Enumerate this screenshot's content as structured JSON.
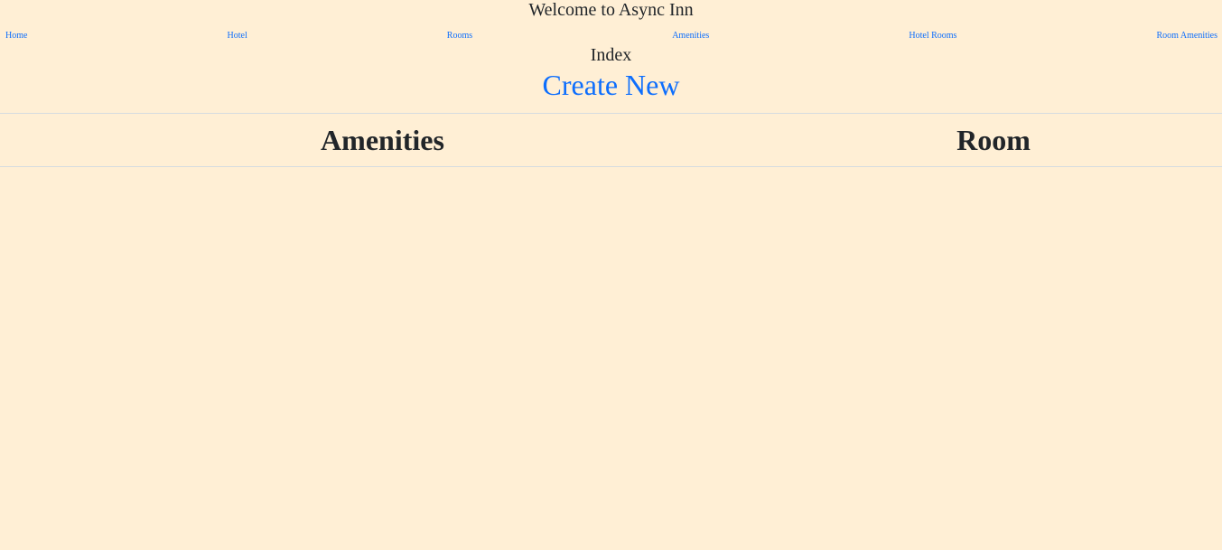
{
  "header": {
    "title": "Welcome to Async Inn"
  },
  "nav": {
    "items": [
      {
        "label": "Home"
      },
      {
        "label": "Hotel"
      },
      {
        "label": "Rooms"
      },
      {
        "label": "Amenities"
      },
      {
        "label": "Hotel Rooms"
      },
      {
        "label": "Room Amenities"
      }
    ]
  },
  "main": {
    "title": "Index",
    "create_label": "Create New",
    "table": {
      "columns": [
        "Amenities",
        "Room"
      ],
      "rows": []
    }
  },
  "colors": {
    "background": "#ffefd5",
    "link": "#0d6efd",
    "text": "#212529",
    "border": "#d6dce0"
  }
}
